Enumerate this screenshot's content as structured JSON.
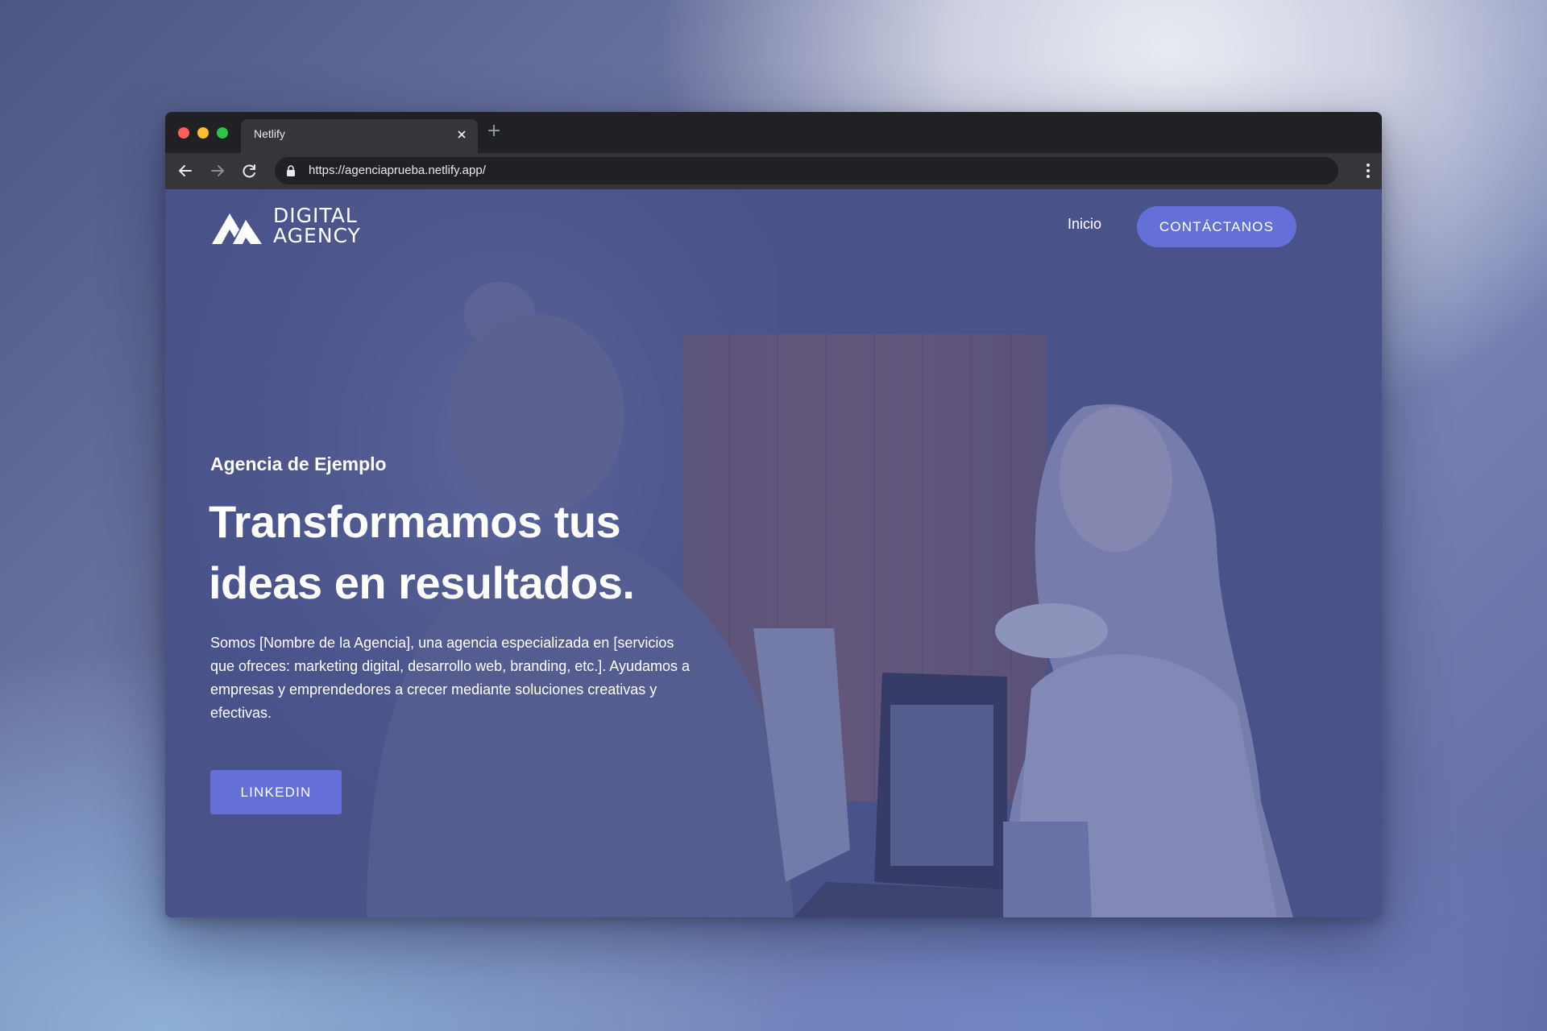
{
  "browser": {
    "tab_title": "Netlify",
    "url": "https://agenciaprueba.netlify.app/"
  },
  "site": {
    "logo_line1": "DIGITAL",
    "logo_line2": "AGENCY",
    "nav_inicio": "Inicio",
    "contact_button": "CONTÁCTANOS",
    "eyebrow": "Agencia de Ejemplo",
    "headline_line1": "Transformamos tus",
    "headline_line2": "ideas en resultados.",
    "intro": "Somos [Nombre de la Agencia], una agencia especializada en [servicios que ofreces: marketing digital, desarrollo web, branding, etc.]. Ayudamos a empresas y emprendedores a crecer mediante soluciones creativas y efectivas.",
    "linkedin_button": "LINKEDIN"
  },
  "colors": {
    "accent": "#6470d8",
    "overlay": "#4b5287",
    "chrome_dark": "#202124",
    "chrome_toolbar": "#35363a"
  },
  "icons": [
    "close-icon",
    "plus-icon",
    "back-arrow-icon",
    "forward-arrow-icon",
    "reload-icon",
    "lock-icon",
    "more-vert-icon",
    "logo-mark-icon"
  ]
}
